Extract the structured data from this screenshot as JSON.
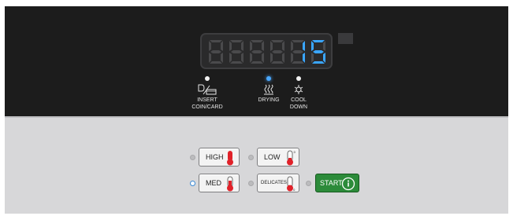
{
  "display": {
    "digits": [
      "",
      "",
      "",
      "",
      "1",
      "5"
    ],
    "value": "15"
  },
  "status_indicators": [
    {
      "id": "insert",
      "label_line1": "INSERT",
      "label_line2": "COIN/CARD",
      "icon": "coin-card-icon",
      "lit": false
    },
    {
      "id": "drying",
      "label_line1": "DRYING",
      "label_line2": "",
      "icon": "heat-waves-icon",
      "lit": true
    },
    {
      "id": "cool",
      "label_line1": "COOL",
      "label_line2": "DOWN",
      "icon": "snowflake-icon",
      "lit": false
    }
  ],
  "buttons": {
    "high": {
      "label": "HIGH",
      "icon": "thermometer-high-icon",
      "lit": false
    },
    "low": {
      "label": "LOW",
      "icon": "thermometer-low-icon",
      "lit": false
    },
    "med": {
      "label": "MED",
      "icon": "thermometer-med-icon",
      "lit": true
    },
    "delicates": {
      "label": "DELICATES",
      "icon": "thermometer-delicates-icon",
      "lit": false
    },
    "start": {
      "label": "START",
      "icon": "play-icon",
      "lit": false
    }
  },
  "colors": {
    "display_digit_on": "#3aa6ff",
    "display_digit_off": "#4a4a4c",
    "led_active": "#4aa8ff",
    "start_green": "#2c8b3a",
    "thermo_red": "#e0222a"
  }
}
